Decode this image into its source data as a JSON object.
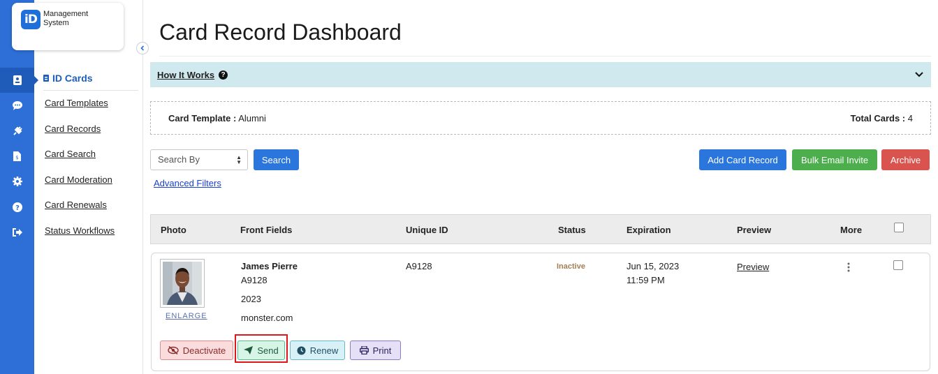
{
  "logo": {
    "badge": "iD",
    "line1": "Management",
    "line2": "System"
  },
  "rail": {
    "icons": [
      "id-card-icon",
      "chat-icon",
      "plug-icon",
      "document-icon",
      "gear-icon",
      "help-icon",
      "sign-out-icon"
    ]
  },
  "nav": {
    "heading": "ID Cards",
    "items": [
      {
        "label": "Card Templates"
      },
      {
        "label": "Card Records"
      },
      {
        "label": "Card Search"
      },
      {
        "label": "Card Moderation"
      },
      {
        "label": "Card Renewals"
      },
      {
        "label": "Status Workflows"
      }
    ]
  },
  "page": {
    "title": "Card Record Dashboard"
  },
  "how_it_works": {
    "label": "How It Works",
    "help_glyph": "?"
  },
  "template_bar": {
    "template_label": "Card Template :",
    "template_value": "Alumni",
    "total_label": "Total Cards :",
    "total_value": "4"
  },
  "toolbar": {
    "search_by_value": "Search By",
    "search_button": "Search",
    "advanced_filters": "Advanced Filters",
    "add_button": "Add Card Record",
    "bulk_button": "Bulk Email Invite",
    "archive_button": "Archive"
  },
  "table": {
    "headers": [
      "Photo",
      "Front Fields",
      "Unique ID",
      "Status",
      "Expiration",
      "Preview",
      "More"
    ],
    "rows": [
      {
        "enlarge": "ENLARGE",
        "name": "James Pierre",
        "field1": "A9128",
        "field2": "2023",
        "field3": "monster.com",
        "unique_id": "A9128",
        "status": "Inactive",
        "expiration_date": "Jun 15, 2023",
        "expiration_time": "11:59 PM",
        "preview": "Preview",
        "actions": {
          "deactivate": "Deactivate",
          "send": "Send",
          "renew": "Renew",
          "print": "Print"
        }
      }
    ]
  },
  "colors": {
    "rail": "#2d6fd6",
    "primary": "#2a76dc",
    "success": "#4cae4c",
    "danger": "#d9534f",
    "info_bar": "#cfe9ee",
    "highlight": "#e0161b"
  }
}
